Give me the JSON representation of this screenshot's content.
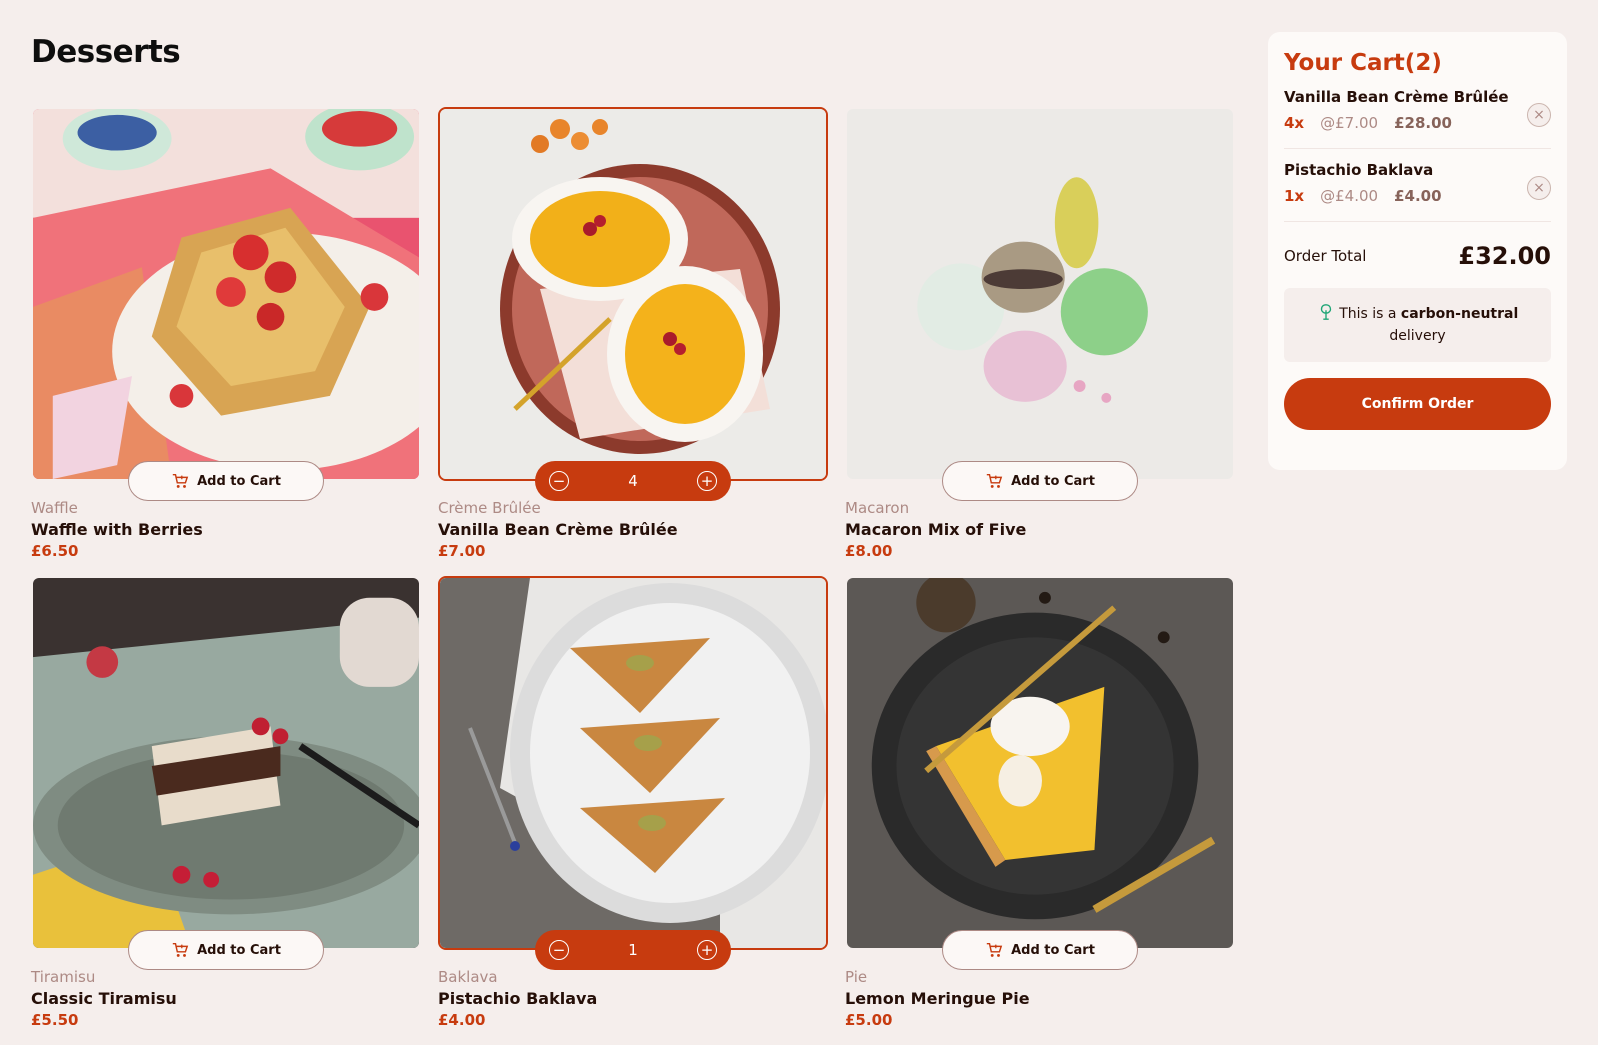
{
  "page": {
    "title": "Desserts"
  },
  "products": [
    {
      "category": "Waffle",
      "name": "Waffle with Berries",
      "price": "£6.50",
      "button": "Add to Cart"
    },
    {
      "category": "Crème Brûlée",
      "name": "Vanilla Bean Crème Brûlée",
      "price": "£7.00",
      "quantity": "4"
    },
    {
      "category": "Macaron",
      "name": "Macaron Mix of Five",
      "price": "£8.00",
      "button": "Add to Cart"
    },
    {
      "category": "Tiramisu",
      "name": "Classic Tiramisu",
      "price": "£5.50",
      "button": "Add to Cart"
    },
    {
      "category": "Baklava",
      "name": "Pistachio Baklava",
      "price": "£4.00",
      "quantity": "1"
    },
    {
      "category": "Pie",
      "name": "Lemon Meringue Pie",
      "price": "£5.00",
      "button": "Add to Cart"
    }
  ],
  "cart": {
    "title": "Your Cart(2)",
    "items": [
      {
        "name": "Vanilla Bean Crème Brûlée",
        "qty": "4x",
        "unit": "@£7.00",
        "total": "£28.00"
      },
      {
        "name": "Pistachio Baklava",
        "qty": "1x",
        "unit": "@£4.00",
        "total": "£4.00"
      }
    ],
    "total_label": "Order Total",
    "total_value": "£32.00",
    "carbon_prefix": "This is a ",
    "carbon_bold": "carbon-neutral",
    "carbon_suffix": "delivery",
    "confirm_label": "Confirm Order"
  },
  "colors": {
    "accent": "#c73b0f",
    "background": "#f5eeec",
    "muted": "#ad8a85",
    "text": "#260f08"
  },
  "icons": [
    "cart-icon",
    "minus-icon",
    "plus-icon",
    "remove-icon",
    "tree-icon"
  ]
}
